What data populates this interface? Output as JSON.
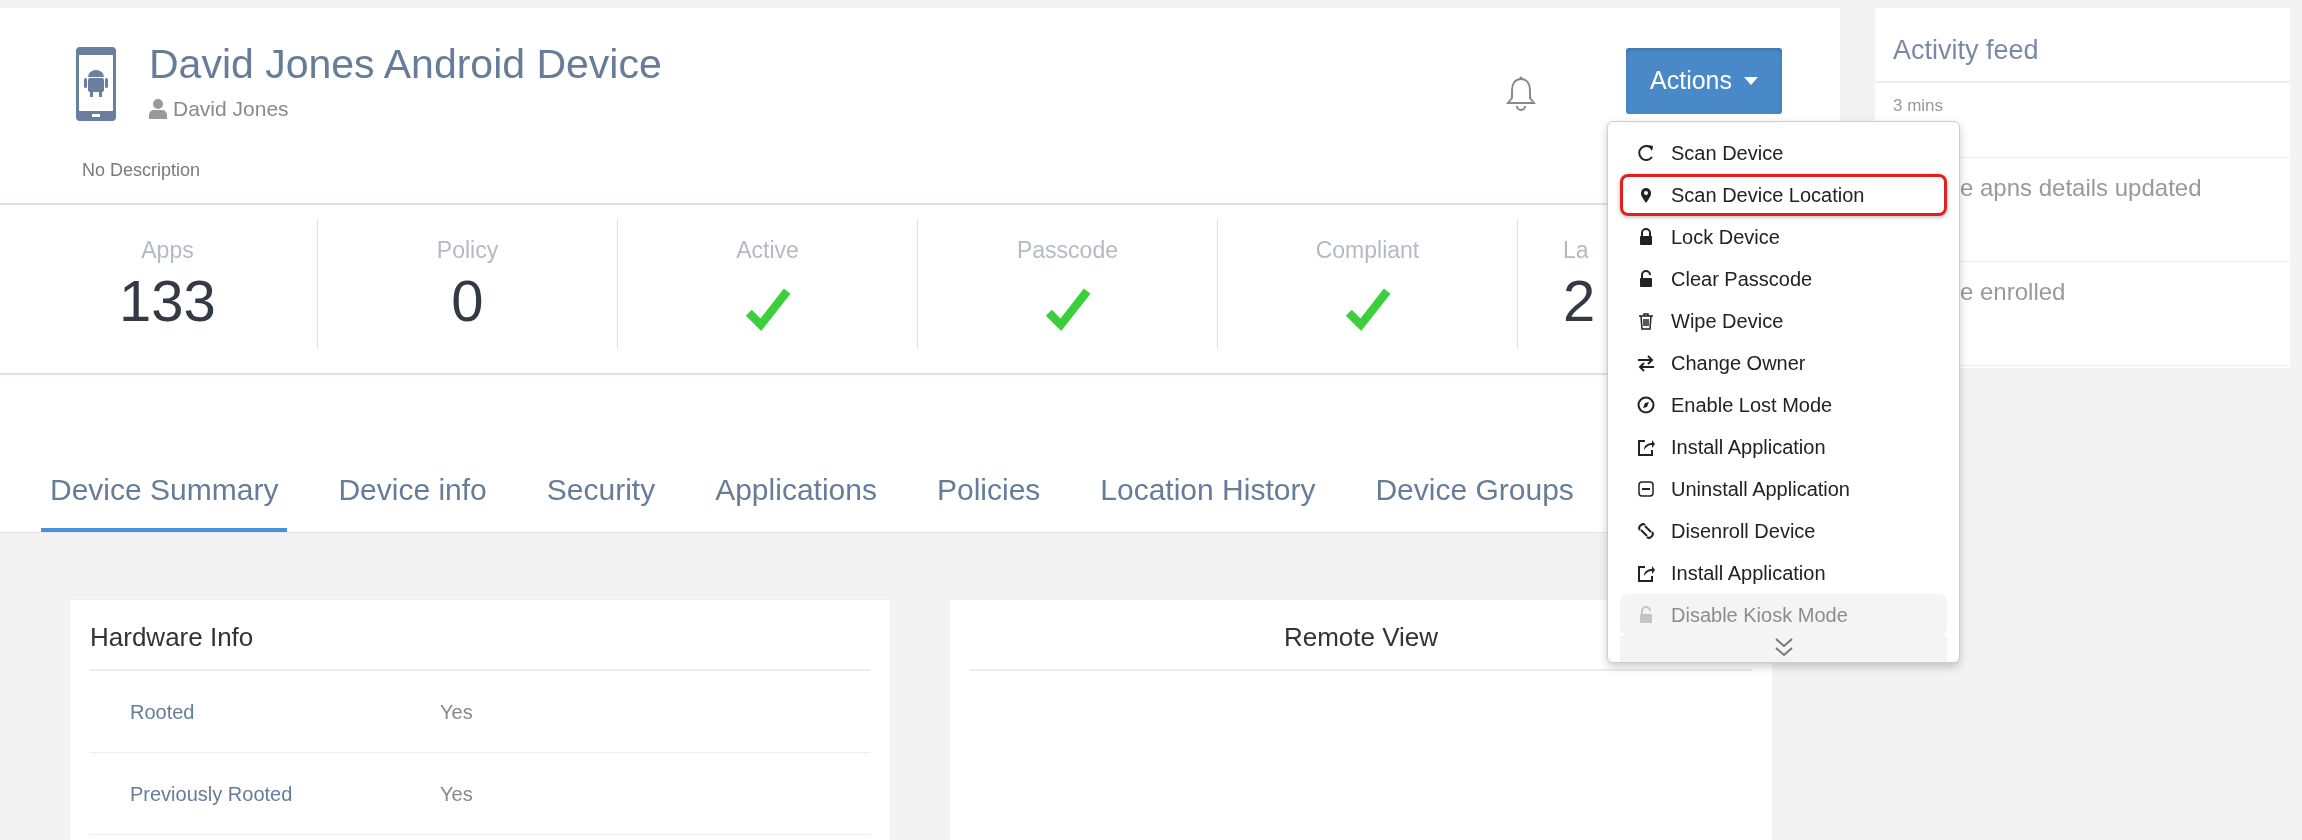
{
  "device": {
    "title": "David Jones Android Device",
    "owner": "David Jones",
    "description": "No Description"
  },
  "actions": {
    "label": "Actions",
    "expanded": true
  },
  "actions_menu": [
    {
      "label": "Scan Device",
      "highlighted": false,
      "disabled": false
    },
    {
      "label": "Scan Device Location",
      "highlighted": true,
      "disabled": false
    },
    {
      "label": "Lock Device",
      "highlighted": false,
      "disabled": false
    },
    {
      "label": "Clear Passcode",
      "highlighted": false,
      "disabled": false
    },
    {
      "label": "Wipe Device",
      "highlighted": false,
      "disabled": false
    },
    {
      "label": "Change Owner",
      "highlighted": false,
      "disabled": false
    },
    {
      "label": "Enable Lost Mode",
      "highlighted": false,
      "disabled": false
    },
    {
      "label": "Install Application",
      "highlighted": false,
      "disabled": false
    },
    {
      "label": "Uninstall Application",
      "highlighted": false,
      "disabled": false
    },
    {
      "label": "Disenroll Device",
      "highlighted": false,
      "disabled": false
    },
    {
      "label": "Install Application",
      "highlighted": false,
      "disabled": false
    },
    {
      "label": "Disable Kiosk Mode",
      "highlighted": false,
      "disabled": true
    }
  ],
  "stats": [
    {
      "label": "Apps",
      "kind": "number",
      "value": "133"
    },
    {
      "label": "Policy",
      "kind": "number",
      "value": "0"
    },
    {
      "label": "Active",
      "kind": "check",
      "ok": true
    },
    {
      "label": "Passcode",
      "kind": "check",
      "ok": true
    },
    {
      "label": "Compliant",
      "kind": "check",
      "ok": true
    },
    {
      "label": "La",
      "kind": "number",
      "value": "2"
    }
  ],
  "tabs": [
    {
      "label": "Device Summary",
      "selected": true
    },
    {
      "label": "Device info",
      "selected": false
    },
    {
      "label": "Security",
      "selected": false
    },
    {
      "label": "Applications",
      "selected": false
    },
    {
      "label": "Policies",
      "selected": false
    },
    {
      "label": "Location History",
      "selected": false
    },
    {
      "label": "Device Groups",
      "selected": false
    }
  ],
  "hardware_info": {
    "title": "Hardware Info",
    "rows": [
      {
        "label": "Rooted",
        "value": "Yes"
      },
      {
        "label": "Previously Rooted",
        "value": "Yes"
      }
    ]
  },
  "remote_view": {
    "title": "Remote View"
  },
  "activity_feed": {
    "title": "Activity feed",
    "time": "3 mins",
    "items": [
      "e apns details updated",
      "e enrolled"
    ]
  }
}
